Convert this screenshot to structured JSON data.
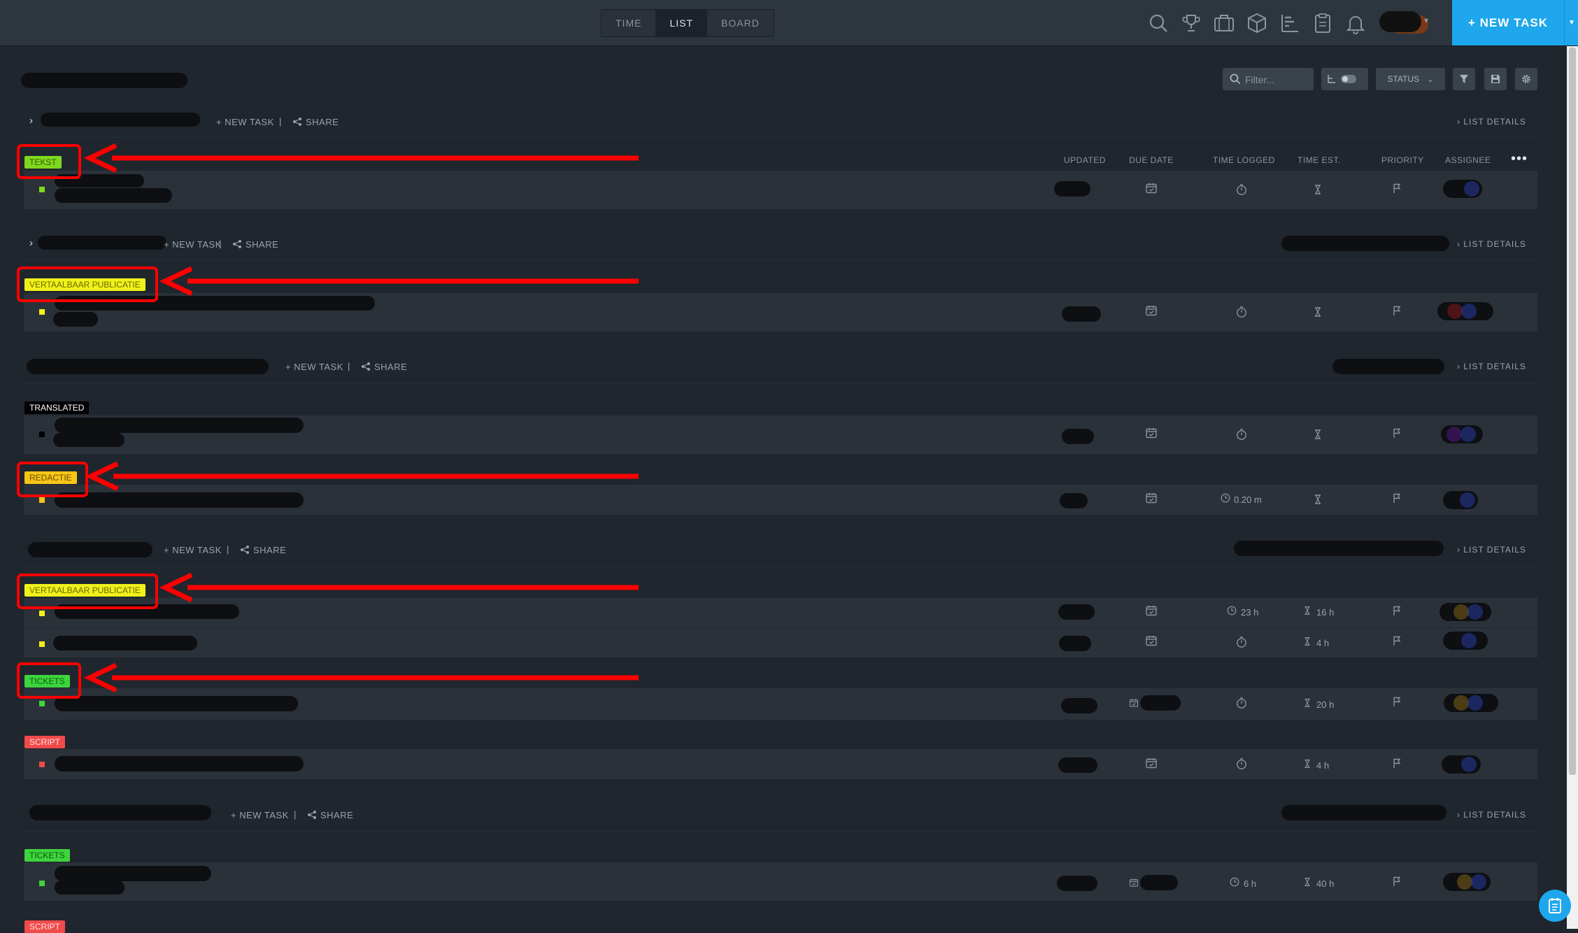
{
  "topbar": {
    "view_tabs": [
      "TIME",
      "LIST",
      "BOARD"
    ],
    "active_view": "LIST",
    "icons": [
      "search-icon",
      "trophy-icon",
      "briefcase-icon",
      "cube-icon",
      "gantt-icon",
      "clipboard-icon",
      "bell-icon"
    ],
    "new_task_label": "+ NEW TASK"
  },
  "toolbar": {
    "filter_placeholder": "Filter...",
    "status_label": "STATUS"
  },
  "lists": {
    "new_task_label": "+ NEW TASK",
    "share_label": "SHARE",
    "list_details_label": "LIST DETAILS",
    "separator": "|"
  },
  "columns": [
    "UPDATED",
    "DUE DATE",
    "TIME LOGGED",
    "TIME EST.",
    "PRIORITY",
    "ASSIGNEE"
  ],
  "statuses": {
    "tekst": "TEKST",
    "vertaalbaar_1": "VERTAALBAAR PUBLICATIE",
    "translated": "TRANSLATED",
    "redactie": "REDACTIE",
    "vertaalbaar_2": "VERTAALBAAR PUBLICATIE",
    "tickets_1": "TICKETS",
    "script_1": "SCRIPT",
    "tickets_2": "TICKETS",
    "script_2": "SCRIPT"
  },
  "status_colors": {
    "tekst": "#7fd81f",
    "vertaalbaar": "#f0f01a",
    "translated": "#000000",
    "redactie": "#f5c518",
    "tickets": "#3dd43d",
    "script": "#f04a4a"
  },
  "task_values": {
    "redactie_logged": "0.20 m",
    "v2_row1_logged": "23 h",
    "v2_row1_est": "16 h",
    "v2_row2_est": "4 h",
    "tickets1_est": "20 h",
    "script1_est": "4 h",
    "tickets2_logged": "6 h",
    "tickets2_est": "40 h"
  }
}
